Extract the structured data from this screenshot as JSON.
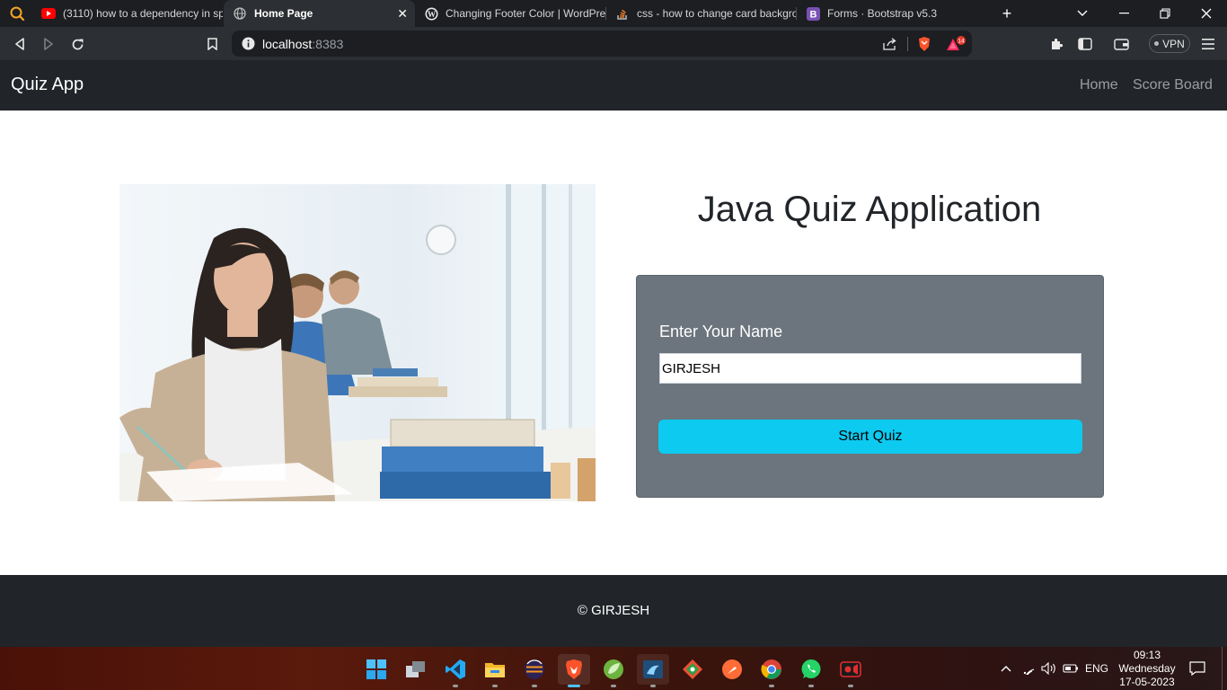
{
  "browser": {
    "tabs": [
      {
        "title": "(3110) how to a dependency in sp",
        "favicon": "youtube-icon",
        "active": false
      },
      {
        "title": "Home Page",
        "favicon": "globe-icon",
        "active": true
      },
      {
        "title": "Changing Footer Color | WordPre",
        "favicon": "wordpress-icon",
        "active": false
      },
      {
        "title": "css - how to change card backgro",
        "favicon": "stackoverflow-icon",
        "active": false
      },
      {
        "title": "Forms · Bootstrap v5.3",
        "favicon": "bootstrap-icon",
        "active": false
      }
    ],
    "close_glyph": "✕",
    "new_tab_glyph": "+",
    "address": {
      "host": "localhost",
      "port": ":8383"
    },
    "shields_badge": "14",
    "vpn_label": "VPN"
  },
  "app": {
    "brand": "Quiz App",
    "nav_links": [
      "Home",
      "Score Board"
    ],
    "heading": "Java Quiz Application",
    "form": {
      "label": "Enter Your Name",
      "name_value": "GIRJESH",
      "submit_label": "Start Quiz"
    },
    "footer_text": "© GIRJESH"
  },
  "taskbar": {
    "apps": [
      "windows-start",
      "task-view",
      "vscode",
      "file-explorer",
      "eclipse",
      "brave",
      "spring-tools",
      "mysql-workbench",
      "git-gui",
      "postman",
      "chrome",
      "whatsapp",
      "screen-recorder"
    ],
    "language": "ENG",
    "time": "09:13",
    "day": "Wednesday",
    "date": "17-05-2023"
  },
  "colors": {
    "navbar": "#212529",
    "card": "#6c757d",
    "button": "#0dcaf0",
    "footer": "#212529"
  }
}
